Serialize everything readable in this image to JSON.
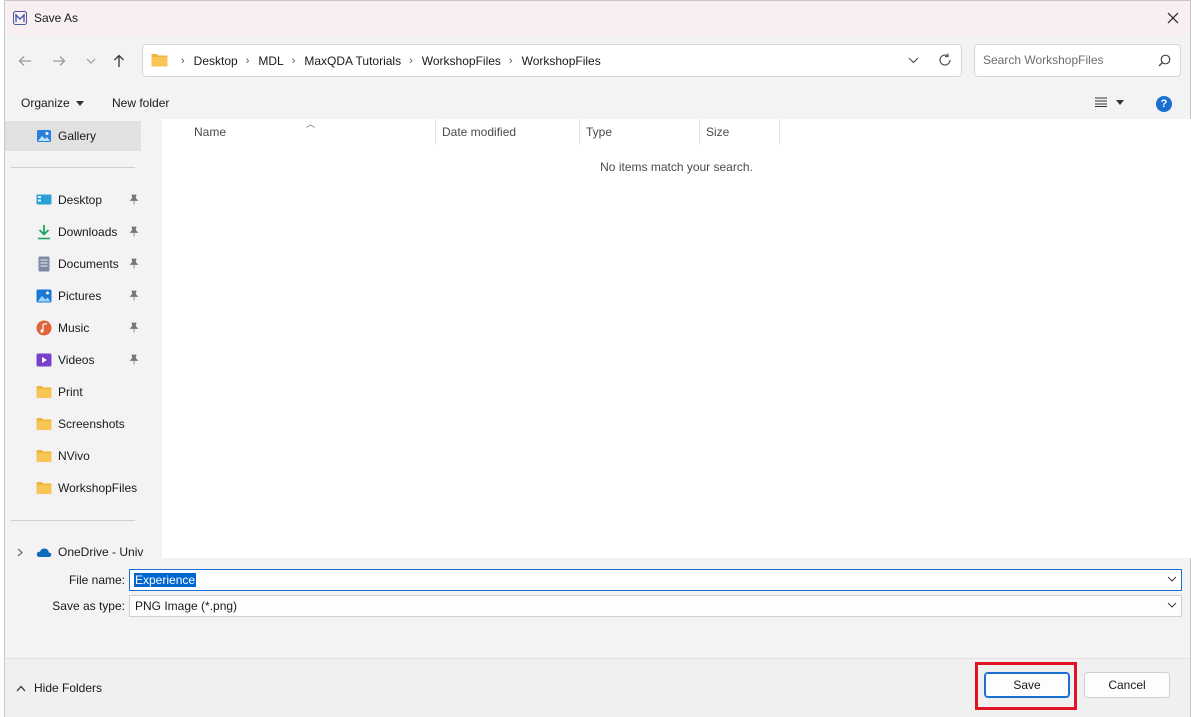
{
  "window": {
    "title": "Save As"
  },
  "nav": {
    "breadcrumbs": [
      "Desktop",
      "MDL",
      "MaxQDA Tutorials",
      "WorkshopFiles",
      "WorkshopFiles"
    ],
    "search_placeholder": "Search WorkshopFiles"
  },
  "toolbar": {
    "organize_label": "Organize",
    "new_folder_label": "New folder",
    "help_label": "?"
  },
  "sidebar": {
    "items": [
      {
        "label": "Gallery",
        "icon": "gallery-icon",
        "pinned": false,
        "selected": true
      },
      {
        "label": "Desktop",
        "icon": "desktop-icon",
        "pinned": true
      },
      {
        "label": "Downloads",
        "icon": "downloads-icon",
        "pinned": true
      },
      {
        "label": "Documents",
        "icon": "documents-icon",
        "pinned": true
      },
      {
        "label": "Pictures",
        "icon": "pictures-icon",
        "pinned": true
      },
      {
        "label": "Music",
        "icon": "music-icon",
        "pinned": true
      },
      {
        "label": "Videos",
        "icon": "videos-icon",
        "pinned": true
      },
      {
        "label": "Print",
        "icon": "folder-icon",
        "pinned": false
      },
      {
        "label": "Screenshots",
        "icon": "folder-icon",
        "pinned": false
      },
      {
        "label": "NVivo",
        "icon": "folder-icon",
        "pinned": false
      },
      {
        "label": "WorkshopFiles",
        "icon": "folder-icon",
        "pinned": false
      },
      {
        "label": "OneDrive - Univ",
        "icon": "onedrive-icon",
        "pinned": false
      }
    ]
  },
  "filelist": {
    "columns": [
      "Name",
      "Date modified",
      "Type",
      "Size"
    ],
    "empty_message": "No items match your search."
  },
  "form": {
    "file_name_label": "File name:",
    "file_name_value": "Experience",
    "save_type_label": "Save as type:",
    "save_type_value": "PNG Image (*.png)"
  },
  "footer": {
    "hide_folders_label": "Hide Folders",
    "save_label": "Save",
    "cancel_label": "Cancel"
  },
  "colors": {
    "accent": "#1a6fd0",
    "highlight": "#e01424",
    "titlebar": "#f8eff0",
    "folder": "#f2b33d"
  }
}
